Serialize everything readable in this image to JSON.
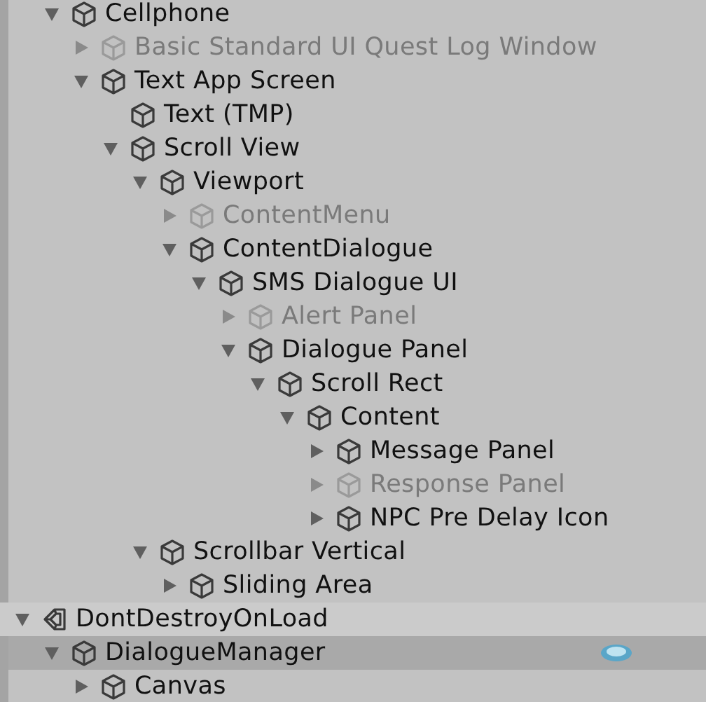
{
  "hierarchy": {
    "continued_items": [
      {
        "name": "Cellphone",
        "active": true,
        "expanded": true,
        "children": [
          {
            "name": "Basic Standard UI Quest Log Window",
            "active": false,
            "expanded": false
          },
          {
            "name": "Text App Screen",
            "active": true,
            "expanded": true,
            "children": [
              {
                "name": "Text (TMP)",
                "active": true
              },
              {
                "name": "Scroll View",
                "active": true,
                "expanded": true,
                "children": [
                  {
                    "name": "Viewport",
                    "active": true,
                    "expanded": true,
                    "children": [
                      {
                        "name": "ContentMenu",
                        "active": false,
                        "expanded": false
                      },
                      {
                        "name": "ContentDialogue",
                        "active": true,
                        "expanded": true,
                        "children": [
                          {
                            "name": "SMS Dialogue UI",
                            "active": true,
                            "expanded": true,
                            "children": [
                              {
                                "name": "Alert Panel",
                                "active": false,
                                "expanded": false
                              },
                              {
                                "name": "Dialogue Panel",
                                "active": true,
                                "expanded": true,
                                "children": [
                                  {
                                    "name": "Scroll Rect",
                                    "active": true,
                                    "expanded": true,
                                    "children": [
                                      {
                                        "name": "Content",
                                        "active": true,
                                        "expanded": true,
                                        "children": [
                                          {
                                            "name": "Message Panel",
                                            "active": true,
                                            "expanded": false
                                          },
                                          {
                                            "name": "Response Panel",
                                            "active": false,
                                            "expanded": false
                                          },
                                          {
                                            "name": "NPC Pre Delay Icon",
                                            "active": true,
                                            "expanded": false
                                          }
                                        ]
                                      }
                                    ]
                                  }
                                ]
                              }
                            ]
                          }
                        ]
                      }
                    ]
                  },
                  {
                    "name": "Scrollbar Vertical",
                    "active": true,
                    "expanded": true,
                    "children": [
                      {
                        "name": "Sliding Area",
                        "active": true,
                        "expanded": false
                      }
                    ]
                  }
                ]
              }
            ]
          }
        ]
      }
    ],
    "scenes": [
      {
        "name": "DontDestroyOnLoad",
        "expanded": true,
        "children": [
          {
            "name": "DialogueManager",
            "active": true,
            "expanded": true,
            "highlighted": true,
            "has_component_icon": true,
            "children": [
              {
                "name": "Canvas",
                "active": true,
                "expanded": false
              }
            ]
          }
        ]
      }
    ]
  }
}
